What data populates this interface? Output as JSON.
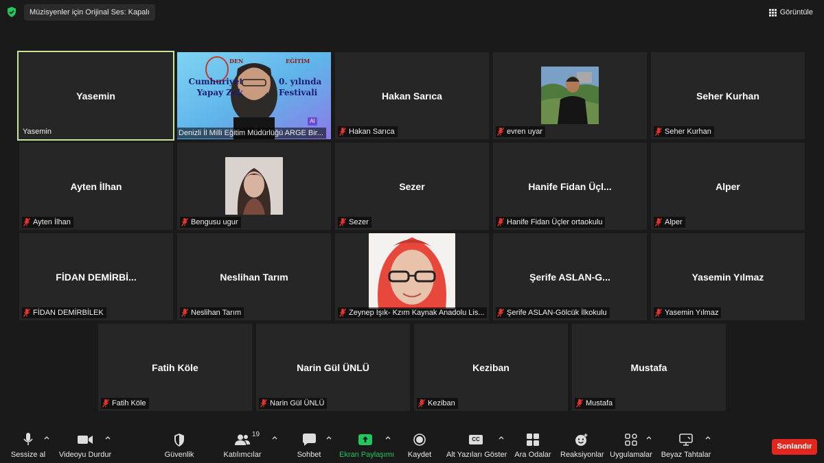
{
  "topbar": {
    "audio_status": "Müzisyenler için Orijinal Ses: Kapalı",
    "view_label": "Görüntüle"
  },
  "banner_text": {
    "line1": "Cumhuriyet",
    "line1b": "0. yılında",
    "line2": "Yapay Zek",
    "line2b": "Festivali",
    "header": "DEN",
    "header2": "EĞİTİM",
    "badge": "AI"
  },
  "tiles": [
    {
      "big": "Yasemin",
      "label": "Yasemin"
    },
    {
      "big": "",
      "label": "Denizli İl Milli Eğitim Müdürlüğü ARGE Bir..."
    },
    {
      "big": "Hakan Sarıca",
      "label": "Hakan Sarıca"
    },
    {
      "big": "",
      "label": "evren uyar"
    },
    {
      "big": "Seher Kurhan",
      "label": "Seher Kurhan"
    },
    {
      "big": "Ayten İlhan",
      "label": "Ayten İlhan"
    },
    {
      "big": "",
      "label": "Bengusu ugur"
    },
    {
      "big": "Sezer",
      "label": "Sezer"
    },
    {
      "big": "Hanife  Fidan  Üçl...",
      "label": "Hanife Fidan Üçler ortaokulu"
    },
    {
      "big": "Alper",
      "label": "Alper"
    },
    {
      "big": "FİDAN  DEMİRBİ...",
      "label": "FİDAN DEMİRBİLEK"
    },
    {
      "big": "Neslihan Tarım",
      "label": "Neslihan Tarım"
    },
    {
      "big": "",
      "label": "Zeynep Işık- Kzım Kaynak Anadolu Lis..."
    },
    {
      "big": "Şerife  ASLAN-G...",
      "label": "Şerife ASLAN-Gölcük İlkokulu"
    },
    {
      "big": "Yasemin Yılmaz",
      "label": "Yasemin Yılmaz"
    },
    {
      "big": "Fatih Köle",
      "label": "Fatih Köle"
    },
    {
      "big": "Narin Gül ÜNLÜ",
      "label": "Narin Gül ÜNLÜ"
    },
    {
      "big": "Keziban",
      "label": "Keziban"
    },
    {
      "big": "Mustafa",
      "label": "Mustafa"
    }
  ],
  "toolbar": {
    "mute": "Sessize al",
    "video": "Videoyu Durdur",
    "security": "Güvenlik",
    "participants": "Katılımcılar",
    "participants_count": "19",
    "chat": "Sohbet",
    "share": "Ekran Paylaşımı",
    "record": "Kaydet",
    "captions": "Alt Yazıları Göster",
    "captions_badge": "CC",
    "breakout": "Ara Odalar",
    "reactions": "Reaksiyonlar",
    "apps": "Uygulamalar",
    "whiteboards": "Beyaz Tahtalar",
    "end": "Sonlandır"
  },
  "colors": {
    "accent_share": "#22c55e",
    "end_button": "#e0281e",
    "active_speaker": "#c7e89a",
    "mic_off": "#e5322b",
    "shield": "#22c55e"
  }
}
